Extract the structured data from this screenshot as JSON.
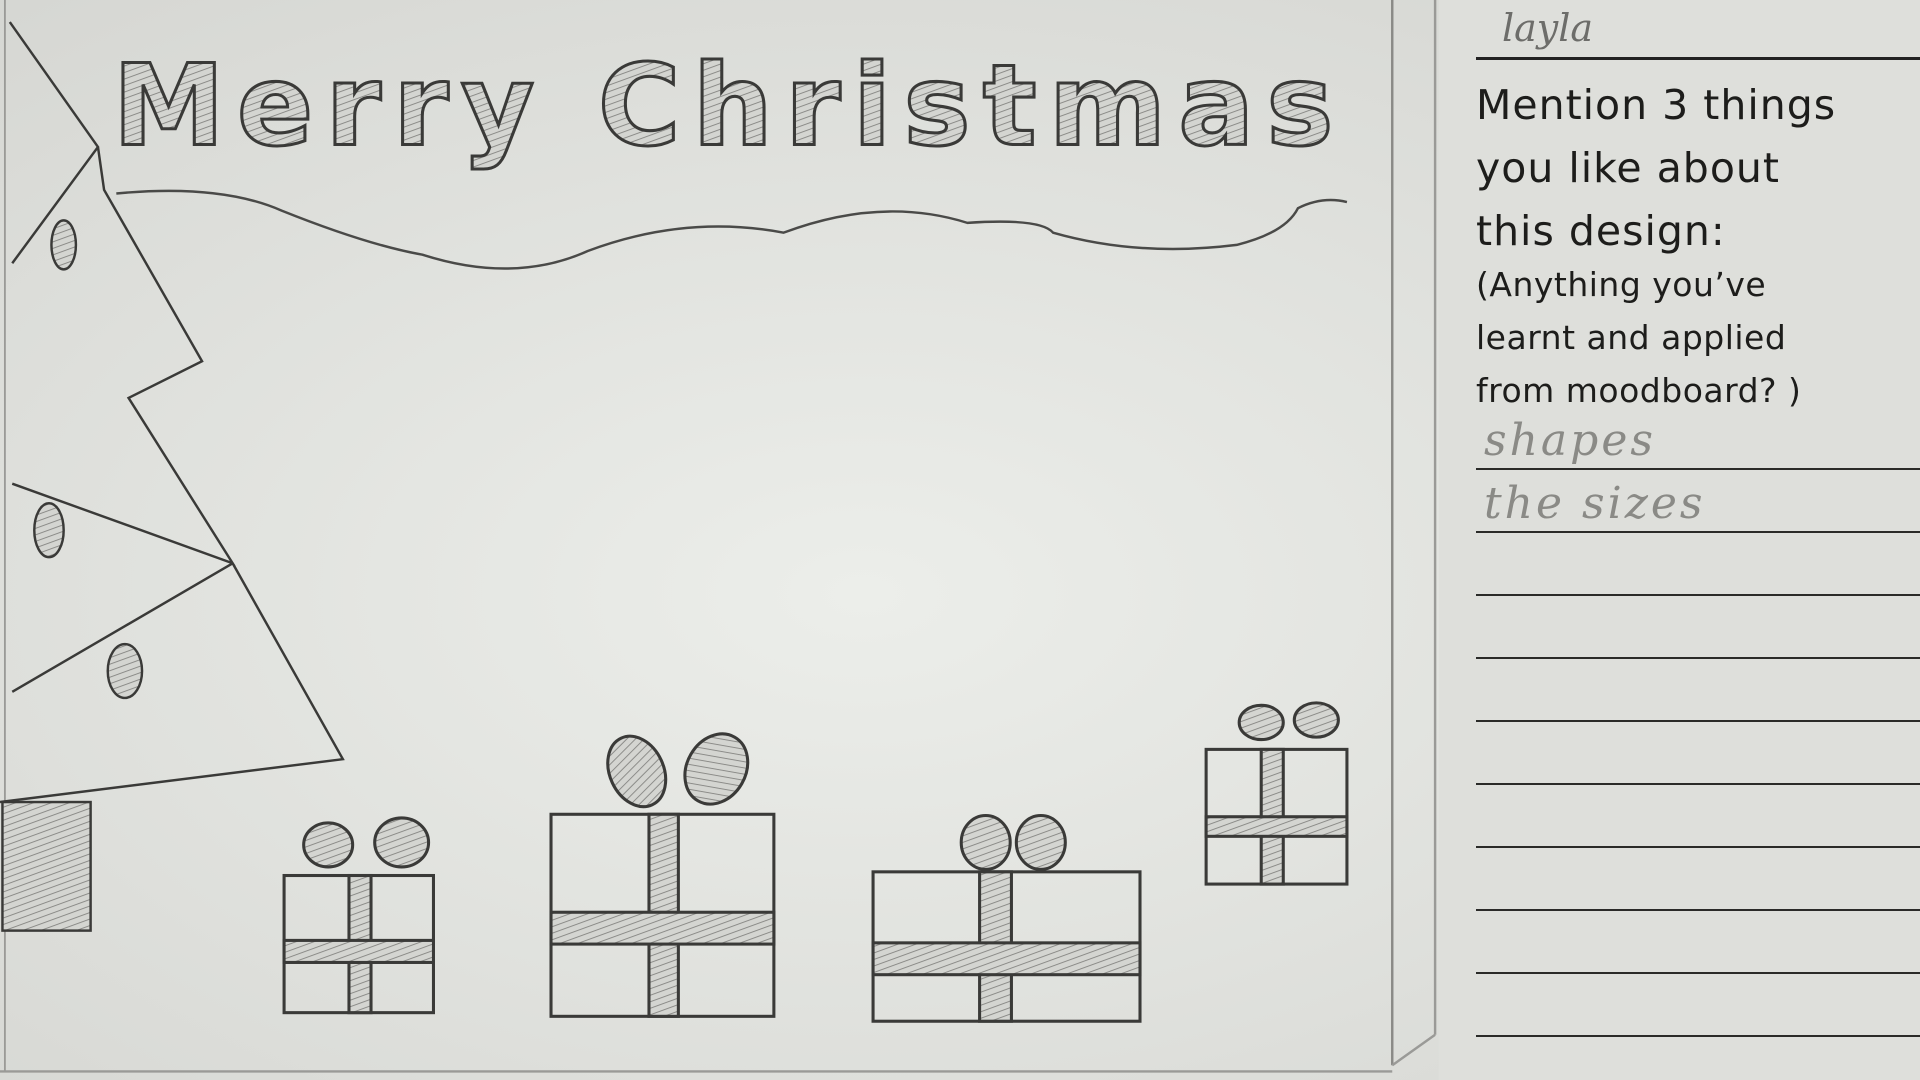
{
  "drawing": {
    "title": "Merry Christmas",
    "paper_color": "#e4e5e1",
    "pencil_color": "#3a3a38"
  },
  "worksheet": {
    "name": "layla",
    "question_lines": [
      "Mention 3 things",
      "you like about",
      "this design:"
    ],
    "hint_lines": [
      "(Anything you’ve",
      "learnt and applied",
      "from moodboard? )"
    ],
    "answers": [
      "shapes",
      "the sizes"
    ],
    "answer_line_count": 10
  }
}
